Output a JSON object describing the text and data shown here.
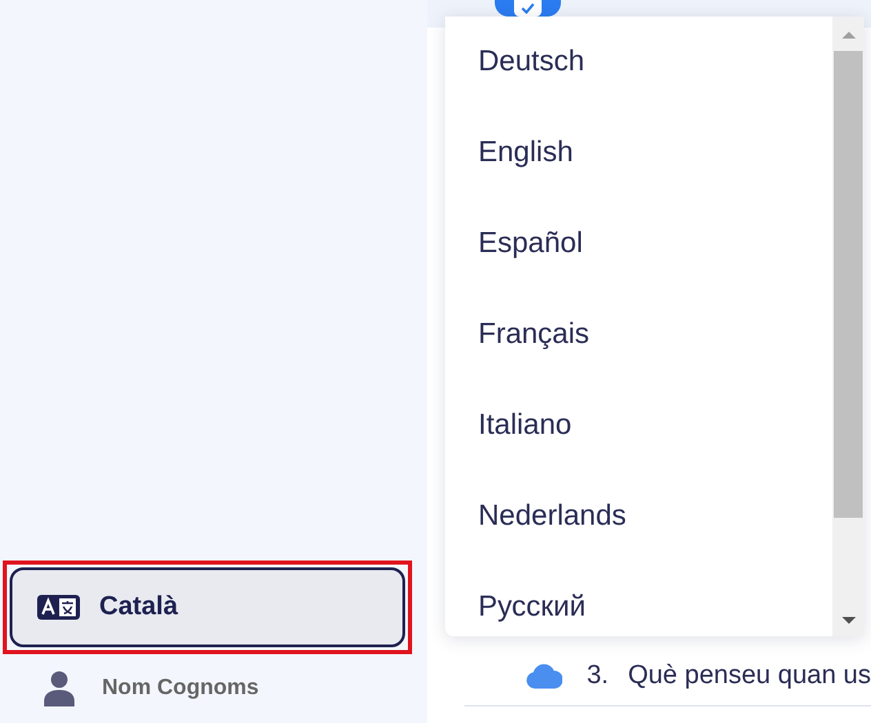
{
  "sidebar": {
    "language_button": {
      "label": "Català",
      "highlighted": true
    },
    "user": {
      "name": "Nom Cognoms"
    }
  },
  "content": {
    "toggle": {
      "checked": true
    },
    "question": {
      "number": "3.",
      "text": "Què penseu quan us"
    }
  },
  "language_menu": {
    "items": [
      {
        "label": "Deutsch",
        "selected": false
      },
      {
        "label": "English",
        "selected": false
      },
      {
        "label": "Español",
        "selected": false
      },
      {
        "label": "Français",
        "selected": false
      },
      {
        "label": "Italiano",
        "selected": false
      },
      {
        "label": "Nederlands",
        "selected": false
      },
      {
        "label": "Русский",
        "selected": false
      }
    ]
  }
}
